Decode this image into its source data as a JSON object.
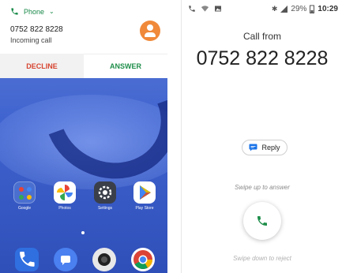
{
  "left_screen": {
    "notification": {
      "app_name": "Phone",
      "caller_number": "0752 822 8228",
      "subtitle": "Incoming call",
      "decline_label": "DECLINE",
      "answer_label": "ANSWER"
    },
    "home_apps": [
      {
        "label": "Google"
      },
      {
        "label": "Photos"
      },
      {
        "label": "Settings"
      },
      {
        "label": "Play Store"
      }
    ],
    "dock_icons": [
      "phone-icon",
      "messages-icon",
      "camera-icon",
      "chrome-icon"
    ]
  },
  "right_screen": {
    "status": {
      "battery": "29%",
      "time": "10:29"
    },
    "call_from_label": "Call from",
    "caller_number": "0752 822 8228",
    "reply_label": "Reply",
    "swipe_up_label": "Swipe up to answer",
    "swipe_down_label": "Swipe down to reject"
  },
  "colors": {
    "answer_green": "#1e8e4a",
    "decline_red": "#d6432f",
    "avatar_orange": "#f0893a",
    "reply_blue": "#1a73e8"
  }
}
